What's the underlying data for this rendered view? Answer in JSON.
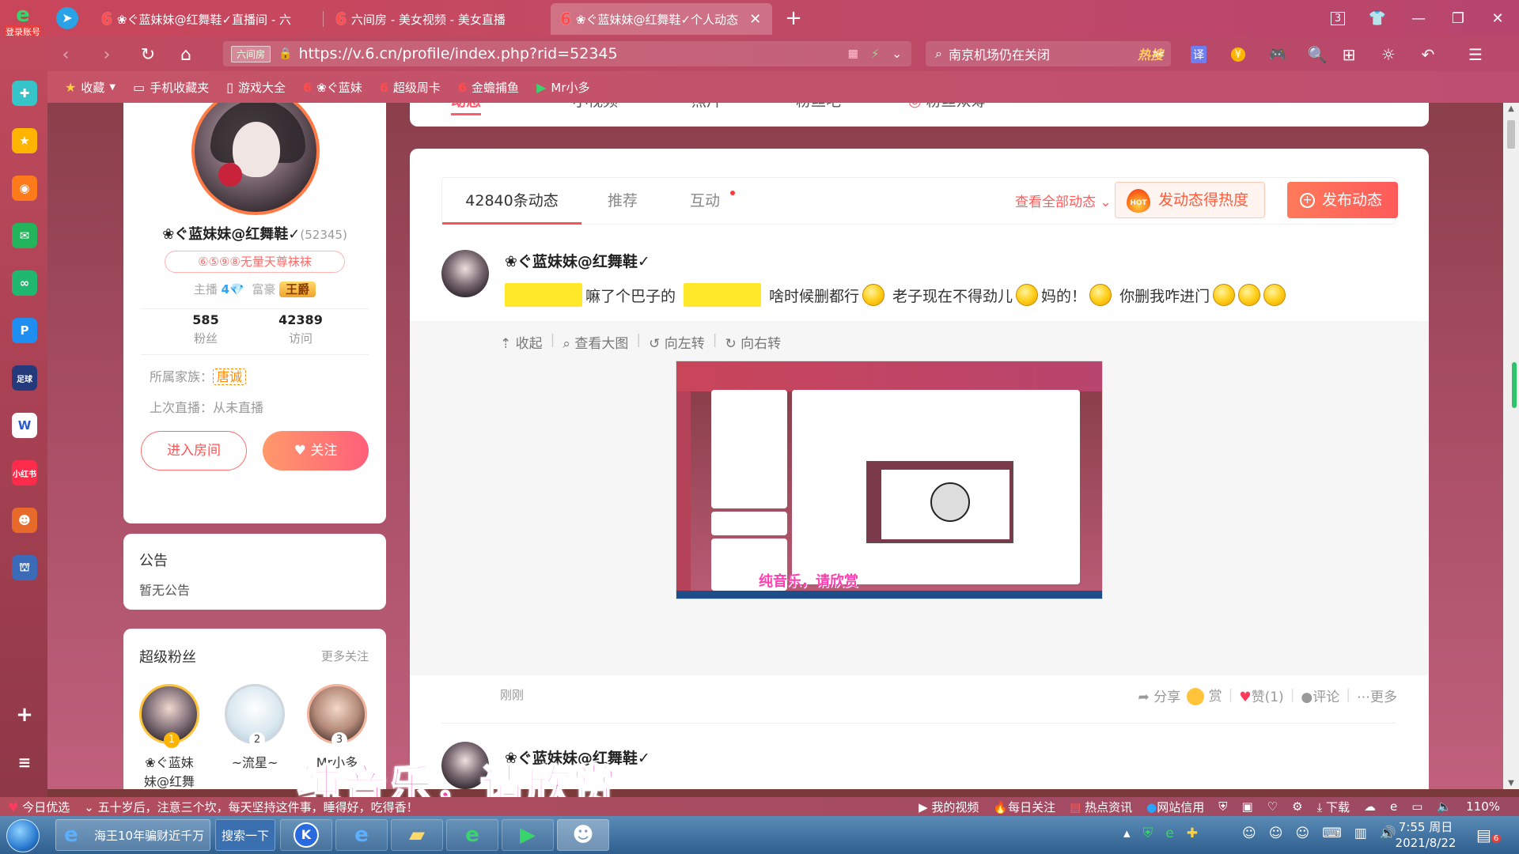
{
  "browser": {
    "left_logo_label": "登录账号",
    "tabs": [
      {
        "title": "❀ぐ蓝妹妹@红舞鞋✓直播间 - 六",
        "active": false
      },
      {
        "title": "六间房 - 美女视频 - 美女直播",
        "active": false
      },
      {
        "title": "❀ぐ蓝妹妹@红舞鞋✓个人动态",
        "active": true
      }
    ],
    "tab_count_badge": "3",
    "url_badge": "六间房",
    "url": "https://v.6.cn/profile/index.php?rid=52345",
    "search_text": "南京机场仍在关闭",
    "search_hot": "热搜",
    "bookmarks": [
      "收藏",
      "手机收藏夹",
      "游戏大全",
      "❀ぐ蓝妹",
      "超级周卡",
      "金蟾捕鱼",
      "Mr小多"
    ]
  },
  "profile": {
    "nickname": "❀ぐ蓝妹妹@红舞鞋✓",
    "rid": "(52345)",
    "fan_title": "⑥⑤⑨⑧无量天尊袜袜",
    "anchor_label": "主播",
    "anchor_level": "4",
    "rich_label": "富豪",
    "rich_badge": "王爵",
    "fans_count": "585",
    "fans_label": "粉丝",
    "visits_count": "42389",
    "visits_label": "访问",
    "family_label": "所属家族：",
    "family_value": "唐诚",
    "last_live": "上次直播：从未直播",
    "enter_room": "进入房间",
    "follow": "关注"
  },
  "notice": {
    "title": "公告",
    "body": "暂无公告"
  },
  "super_fans": {
    "title": "超级粉丝",
    "more": "更多关注",
    "items": [
      {
        "rank": "1",
        "name_line1": "❀ぐ蓝妹",
        "name_line2": "妹@红舞"
      },
      {
        "rank": "2",
        "name_line1": "~流星~",
        "name_line2": ""
      },
      {
        "rank": "3",
        "name_line1": "Mr小多",
        "name_line2": ""
      }
    ]
  },
  "top_tabs": [
    "动态",
    "小视频",
    "照片",
    "粉丝吧",
    "粉丝众筹"
  ],
  "feed": {
    "tabs": [
      "42840条动态",
      "推荐",
      "互动"
    ],
    "view_all": "查看全部动态",
    "hot_button": "发动态得热度",
    "hot_icon_text": "HOT",
    "post_button": "发布动态",
    "post": {
      "author": "❀ぐ蓝妹妹@红舞鞋✓",
      "seg1": "嘛了个巴子的",
      "seg2": "啥时候删都行",
      "seg3": "老子现在不得劲儿",
      "seg4": "妈的！",
      "seg5": "你删我咋进门",
      "actions": [
        "收起",
        "查看大图",
        "向左转",
        "向右转"
      ],
      "image_caption": "纯音乐，请欣赏",
      "time": "刚刚",
      "ops": {
        "share": "分享",
        "reward": "赏",
        "like": "赞(1)",
        "comment": "评论",
        "more": "更多"
      }
    },
    "post2_author": "❀ぐ蓝妹妹@红舞鞋✓"
  },
  "overlay_caption": "纯音乐，请欣赏",
  "statusbar": {
    "left": "今日优选",
    "news": "五十岁后，注意三个坎，每天坚持这件事，睡得好，吃得香！",
    "items": [
      "我的视频",
      "每日关注",
      "热点资讯",
      "网站信用",
      "下载"
    ],
    "zoom": "110%"
  },
  "taskbar": {
    "ie_label": "海王10年骗财近千万",
    "search_label": "搜索一下",
    "time": "7:55 周日",
    "date": "2021/8/22"
  }
}
